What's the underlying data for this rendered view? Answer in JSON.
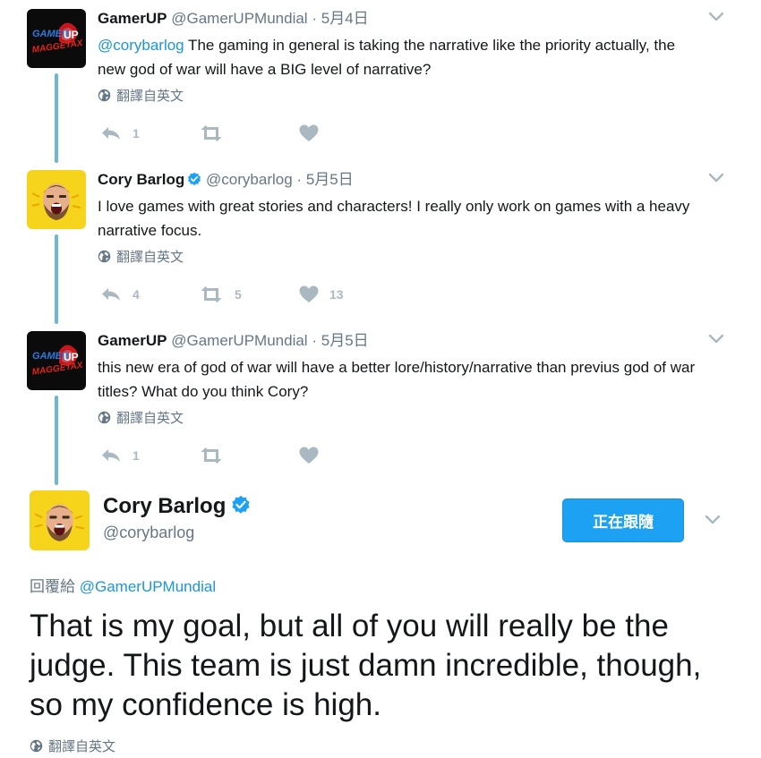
{
  "tweets": [
    {
      "name": "GamerUP",
      "handle": "@GamerUPMundial",
      "separator": "·",
      "date": "5月4日",
      "verified": false,
      "mention": "@corybarlog",
      "text": " The gaming in general is taking the narrative like the priority actually, the new god of war will have a BIG level of narrative?",
      "translate": "翻譯自英文",
      "replies": "1",
      "retweets": "",
      "likes": "",
      "avatar_logo": [
        "GAMER",
        "UP",
        "MAGGETAX"
      ]
    },
    {
      "name": "Cory Barlog",
      "handle": "@corybarlog",
      "separator": "·",
      "date": "5月5日",
      "verified": true,
      "mention": "",
      "text": "I love games with great stories and characters! I really only work on games with a heavy narrative focus.",
      "translate": "翻譯自英文",
      "replies": "4",
      "retweets": "5",
      "likes": "13"
    },
    {
      "name": "GamerUP",
      "handle": "@GamerUPMundial",
      "separator": "·",
      "date": "5月5日",
      "verified": false,
      "mention": "",
      "text": "this new era of god of war will have a better lore/history/narrative than previus god of war titles? What do you think Cory?",
      "translate": "翻譯自英文",
      "replies": "1",
      "retweets": "",
      "likes": "",
      "avatar_logo": [
        "GAMER",
        "UP",
        "MAGGETAX"
      ]
    }
  ],
  "main_tweet": {
    "name": "Cory Barlog",
    "handle": "@corybarlog",
    "verified": true,
    "follow_button": "正在跟隨",
    "reply_prefix": "回覆給",
    "reply_to": "@GamerUPMundial",
    "text": "That is my goal, but all of you will really be the judge.  This team is just damn incredible, though, so my confidence is high.",
    "translate": "翻譯自英文"
  },
  "colors": {
    "link": "#1b95e0",
    "button": "#1da1f2",
    "thread_line": "#6db8d0",
    "muted": "#657786",
    "action_icon": "#aab8c2"
  },
  "icons": [
    "reply-icon",
    "retweet-icon",
    "heart-icon",
    "globe-icon",
    "verified-icon",
    "chevron-down-icon"
  ]
}
